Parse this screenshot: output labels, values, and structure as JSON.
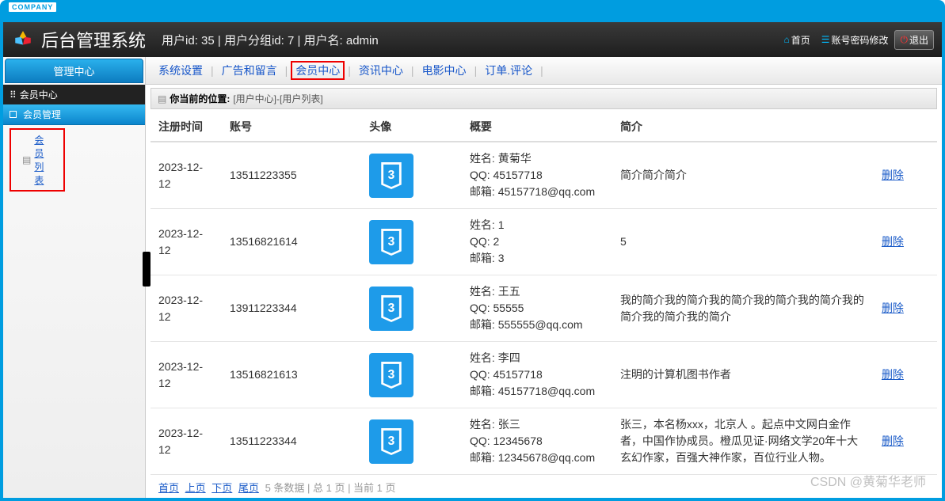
{
  "window": {
    "company": "COMPANY"
  },
  "header": {
    "title": "后台管理系统",
    "info": "用户id:  35 | 用户分组id:  7 | 用户名:  admin",
    "home": "首页",
    "pwd": "账号密码修改",
    "exit": "退出"
  },
  "sidebar": {
    "tab": "管理中心",
    "group": "会员中心",
    "sub": "会员管理",
    "item": "会员列表"
  },
  "menubar": {
    "items": [
      "系统设置",
      "广告和留言",
      "会员中心",
      "资讯中心",
      "电影中心",
      "订单.评论"
    ],
    "highlight_index": 2
  },
  "breadcrumb": {
    "label": "你当前的位置:",
    "path": "[用户中心]-[用户列表]"
  },
  "table": {
    "headers": [
      "注册时间",
      "账号",
      "头像",
      "概要",
      "简介",
      ""
    ],
    "rows": [
      {
        "date": "2023-12-12",
        "acct": "13511223355",
        "summary": "姓名:  黄菊华\nQQ:  45157718\n邮箱:  45157718@qq.com",
        "intro": "简介简介简介",
        "del": "删除"
      },
      {
        "date": "2023-12-12",
        "acct": "13516821614",
        "summary": "姓名:  1\nQQ:  2\n邮箱:  3",
        "intro": "5",
        "del": "删除"
      },
      {
        "date": "2023-12-12",
        "acct": "13911223344",
        "summary": "姓名:  王五\nQQ:  55555\n邮箱:  555555@qq.com",
        "intro": "我的简介我的简介我的简介我的简介我的简介我的简介我的简介我的简介",
        "del": "删除"
      },
      {
        "date": "2023-12-12",
        "acct": "13516821613",
        "summary": "姓名:  李四\nQQ:  45157718\n邮箱:  45157718@qq.com",
        "intro": "注明的计算机图书作者",
        "del": "删除"
      },
      {
        "date": "2023-12-12",
        "acct": "13511223344",
        "summary": "姓名:  张三\nQQ:  12345678\n邮箱:  12345678@qq.com",
        "intro": "张三，本名杨xxx，北京人 。起点中文网白金作者，中国作协成员。橙瓜见证·网络文学20年十大玄幻作家，百强大神作家，百位行业人物。",
        "del": "删除"
      }
    ]
  },
  "pager": {
    "first": "首页",
    "prev": "上页",
    "next": "下页",
    "last": "尾页",
    "info": "5 条数据  | 总 1 页  | 当前 1 页"
  },
  "watermark": "CSDN @黄菊华老师"
}
